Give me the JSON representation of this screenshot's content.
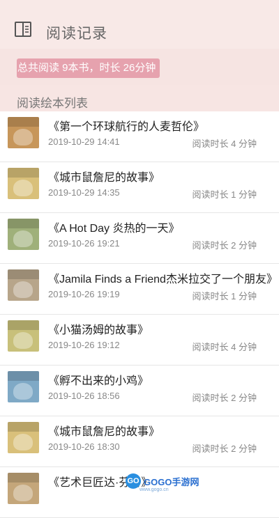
{
  "header": {
    "title": "阅读记录",
    "back_icon": "book-open-icon"
  },
  "summary": {
    "text": "总共阅读 9本书，时长 26分钟"
  },
  "section": {
    "title": "阅读绘本列表"
  },
  "colors": {
    "header_bg": "#f8e9e7",
    "badge_bg": "#e6a2ae",
    "text_muted": "#888888"
  },
  "books": [
    {
      "title": "《第一个环球航行的人麦哲伦》",
      "date": "2019-10-29 14:41",
      "duration": "阅读时长 4 分钟",
      "cover_color": "#c7965a"
    },
    {
      "title": "《城市鼠詹尼的故事》",
      "date": "2019-10-29 14:35",
      "duration": "阅读时长 1 分钟",
      "cover_color": "#d9c07a"
    },
    {
      "title": "《A Hot Day  炎热的一天》",
      "date": "2019-10-26 19:21",
      "duration": "阅读时长 2 分钟",
      "cover_color": "#9fb07a"
    },
    {
      "title": "《Jamila Finds a Friend杰米拉交了一个朋友》",
      "date": "2019-10-26 19:19",
      "duration": "阅读时长 1 分钟",
      "cover_color": "#b7a58a"
    },
    {
      "title": "《小猫汤姆的故事》",
      "date": "2019-10-26 19:12",
      "duration": "阅读时长 4 分钟",
      "cover_color": "#c8c07a"
    },
    {
      "title": "《孵不出来的小鸡》",
      "date": "2019-10-26 18:56",
      "duration": "阅读时长 2 分钟",
      "cover_color": "#7fa9c6"
    },
    {
      "title": "《城市鼠詹尼的故事》",
      "date": "2019-10-26 18:30",
      "duration": "阅读时长 2 分钟",
      "cover_color": "#d9c07a"
    },
    {
      "title": "《艺术巨匠达·芬奇》",
      "date": "",
      "duration": "",
      "cover_color": "#c4a67a"
    }
  ],
  "watermark": {
    "logo_text": "GO",
    "name": "GOGO手游网",
    "sub": "www.gogo.cn"
  }
}
